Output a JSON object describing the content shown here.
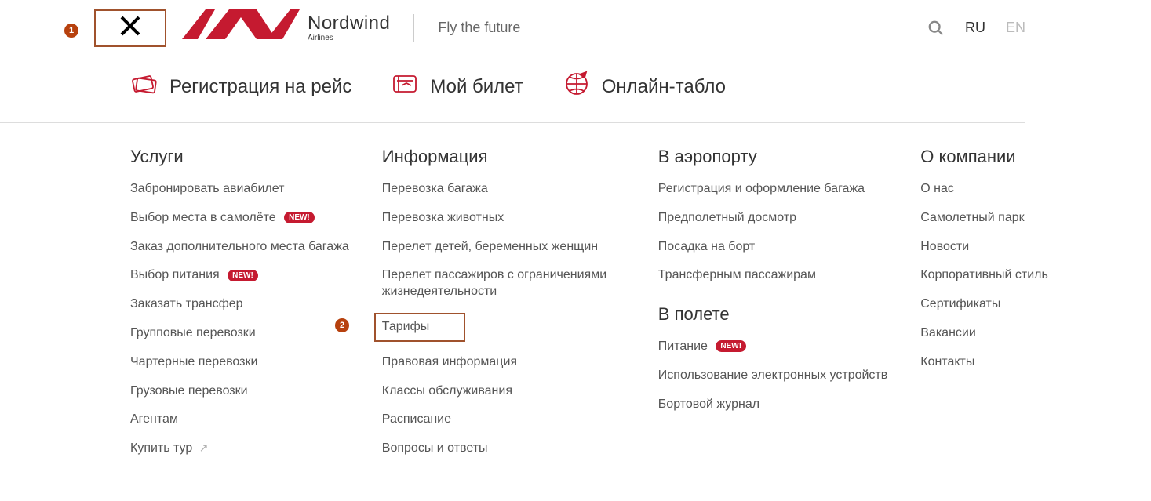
{
  "header": {
    "logo_main": "Nordwind",
    "logo_sub": "Airlines",
    "tagline": "Fly the future",
    "lang_ru": "RU",
    "lang_en": "EN"
  },
  "quick_links": {
    "checkin": "Регистрация на рейс",
    "ticket": "Мой билет",
    "board": "Онлайн-табло"
  },
  "badges": {
    "new": "NEW!"
  },
  "cols": {
    "services": {
      "title": "Услуги",
      "items": {
        "book": "Забронировать авиабилет",
        "seat": "Выбор места в самолёте",
        "extra_seat": "Заказ дополнительного места багажа",
        "meal": "Выбор питания",
        "transfer": "Заказать трансфер",
        "group": "Групповые перевозки",
        "charter": "Чартерные перевозки",
        "cargo": "Грузовые перевозки",
        "agents": "Агентам",
        "tour": "Купить тур"
      }
    },
    "info": {
      "title": "Информация",
      "items": {
        "baggage": "Перевозка багажа",
        "animals": "Перевозка животных",
        "children": "Перелет детей, беременных женщин",
        "disabled": "Перелет пассажиров с ограничениями жизнедеятельности",
        "tariffs": "Тарифы",
        "legal": "Правовая информация",
        "classes": "Классы обслуживания",
        "schedule": "Расписание",
        "faq": "Вопросы и ответы"
      }
    },
    "airport": {
      "title": "В аэропорту",
      "items": {
        "reg_baggage": "Регистрация и оформление багажа",
        "security": "Предполетный досмотр",
        "boarding": "Посадка на борт",
        "transfer_pax": "Трансферным пассажирам"
      }
    },
    "inflight": {
      "title": "В полете",
      "items": {
        "food": "Питание",
        "devices": "Использование электронных устройств",
        "magazine": "Бортовой журнал"
      }
    },
    "company": {
      "title": "О компании",
      "items": {
        "about": "О нас",
        "fleet": "Самолетный парк",
        "news": "Новости",
        "style": "Корпоративный стиль",
        "certs": "Сертификаты",
        "jobs": "Вакансии",
        "contacts": "Контакты"
      }
    }
  },
  "markers": {
    "m1": "1",
    "m2": "2"
  }
}
